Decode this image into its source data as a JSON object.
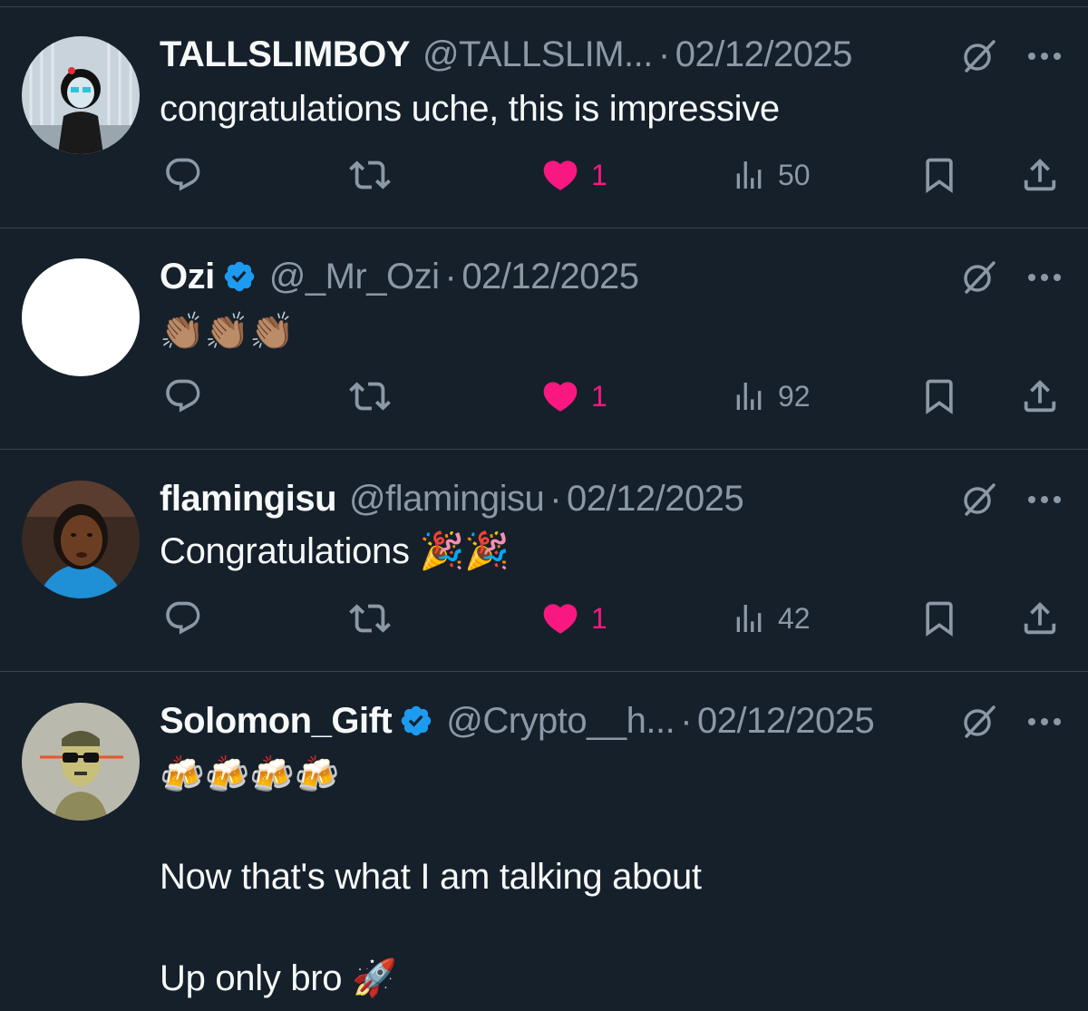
{
  "tweets": [
    {
      "display_name": "TALLSLIMBOY",
      "verified": false,
      "handle": "@TALLSLIM...",
      "separator": "·",
      "date": "02/12/2025",
      "text": "congratulations uche, this is impressive",
      "likes": "1",
      "views": "50"
    },
    {
      "display_name": "Ozi",
      "verified": true,
      "handle": "@_Mr_Ozi",
      "separator": "·",
      "date": "02/12/2025",
      "text": "👏🏽👏🏽👏🏽",
      "likes": "1",
      "views": "92"
    },
    {
      "display_name": "flamingisu",
      "verified": false,
      "handle": "@flamingisu",
      "separator": "·",
      "date": "02/12/2025",
      "text": "Congratulations 🎉🎉",
      "likes": "1",
      "views": "42"
    },
    {
      "display_name": "Solomon_Gift",
      "verified": true,
      "handle": "@Crypto__h...",
      "separator": "·",
      "date": "02/12/2025",
      "text_line1": "🍻🍻🍻🍻",
      "text_line2": "Now that's what I am talking about",
      "text_line3": "Up only bro 🚀"
    }
  ],
  "colors": {
    "background": "#15202b",
    "primary_text": "#f7f9f9",
    "secondary_text": "#8b98a5",
    "like_pink": "#f91880",
    "verified_blue": "#1d9bf0",
    "divider": "#38444d"
  },
  "icons": [
    "reply-icon",
    "retweet-icon",
    "heart-icon",
    "views-icon",
    "bookmark-icon",
    "share-icon",
    "grok-icon",
    "more-icon",
    "verified-badge-icon"
  ]
}
